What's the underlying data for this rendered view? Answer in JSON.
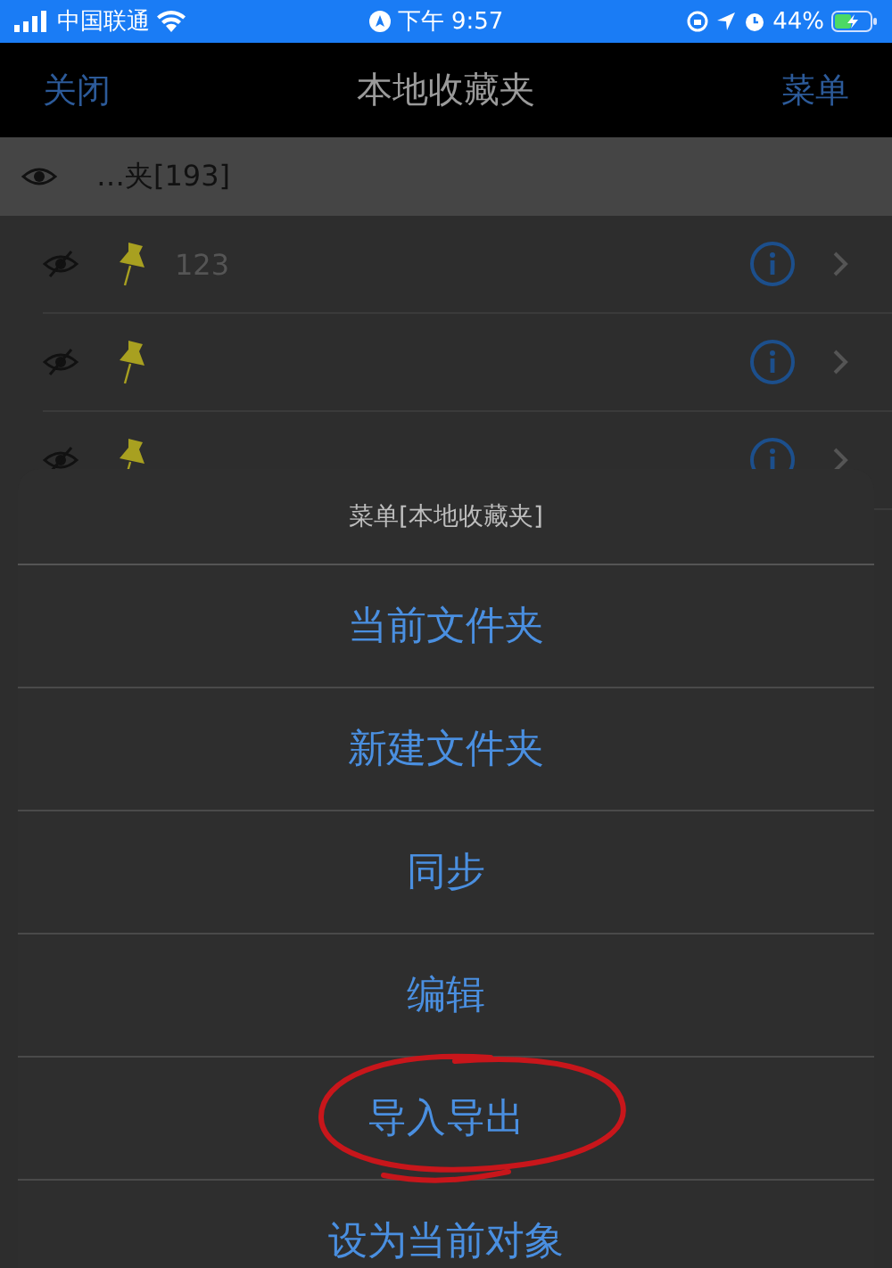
{
  "status_bar": {
    "carrier": "中国联通",
    "time": "下午 9:57",
    "battery": "44%"
  },
  "nav_bar": {
    "left": "关闭",
    "title": "本地收藏夹",
    "right": "菜单"
  },
  "folder_header": {
    "title": "…夹[193]"
  },
  "rows": [
    {
      "title": "123"
    },
    {
      "title": ""
    },
    {
      "title": ""
    }
  ],
  "action_sheet": {
    "title": "菜单[本地收藏夹]",
    "items": [
      {
        "label": "当前文件夹",
        "circled": false
      },
      {
        "label": "新建文件夹",
        "circled": false
      },
      {
        "label": "同步",
        "circled": false
      },
      {
        "label": "编辑",
        "circled": false
      },
      {
        "label": "导入导出",
        "circled": true
      },
      {
        "label": "设为当前对象",
        "circled": false
      }
    ]
  }
}
